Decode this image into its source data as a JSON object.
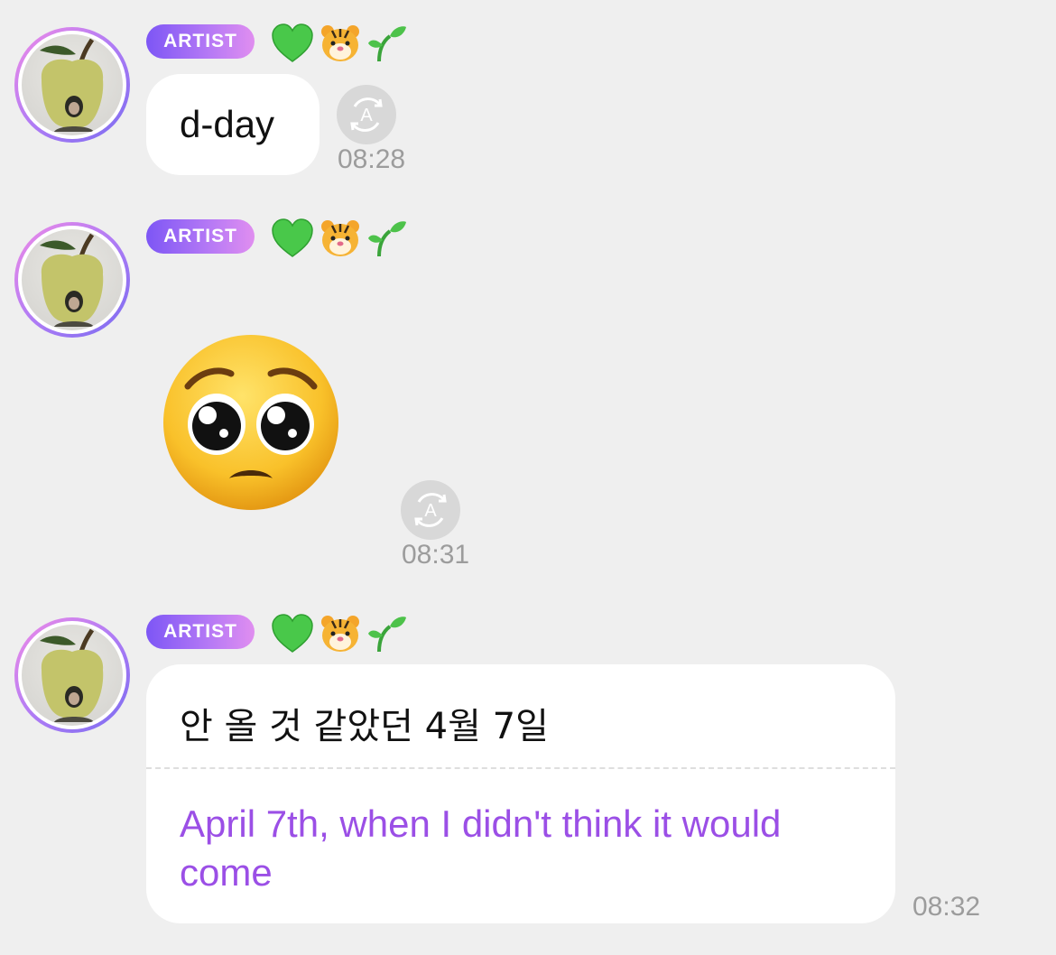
{
  "badge_label": "ARTIST",
  "emoji_icons": [
    "green-heart-icon",
    "tiger-face-icon",
    "seedling-icon"
  ],
  "messages": [
    {
      "text": "d-day",
      "time": "08:28"
    },
    {
      "emoji": "pleading-face-icon",
      "time": "08:31"
    },
    {
      "text": "안 올 것 같았던 4월 7일",
      "translation": "April 7th, when I didn't think it would come",
      "time": "08:32"
    }
  ],
  "colors": {
    "accent": "#8f4ee8",
    "translation_text": "#9b4fe6",
    "background": "#efefef"
  }
}
